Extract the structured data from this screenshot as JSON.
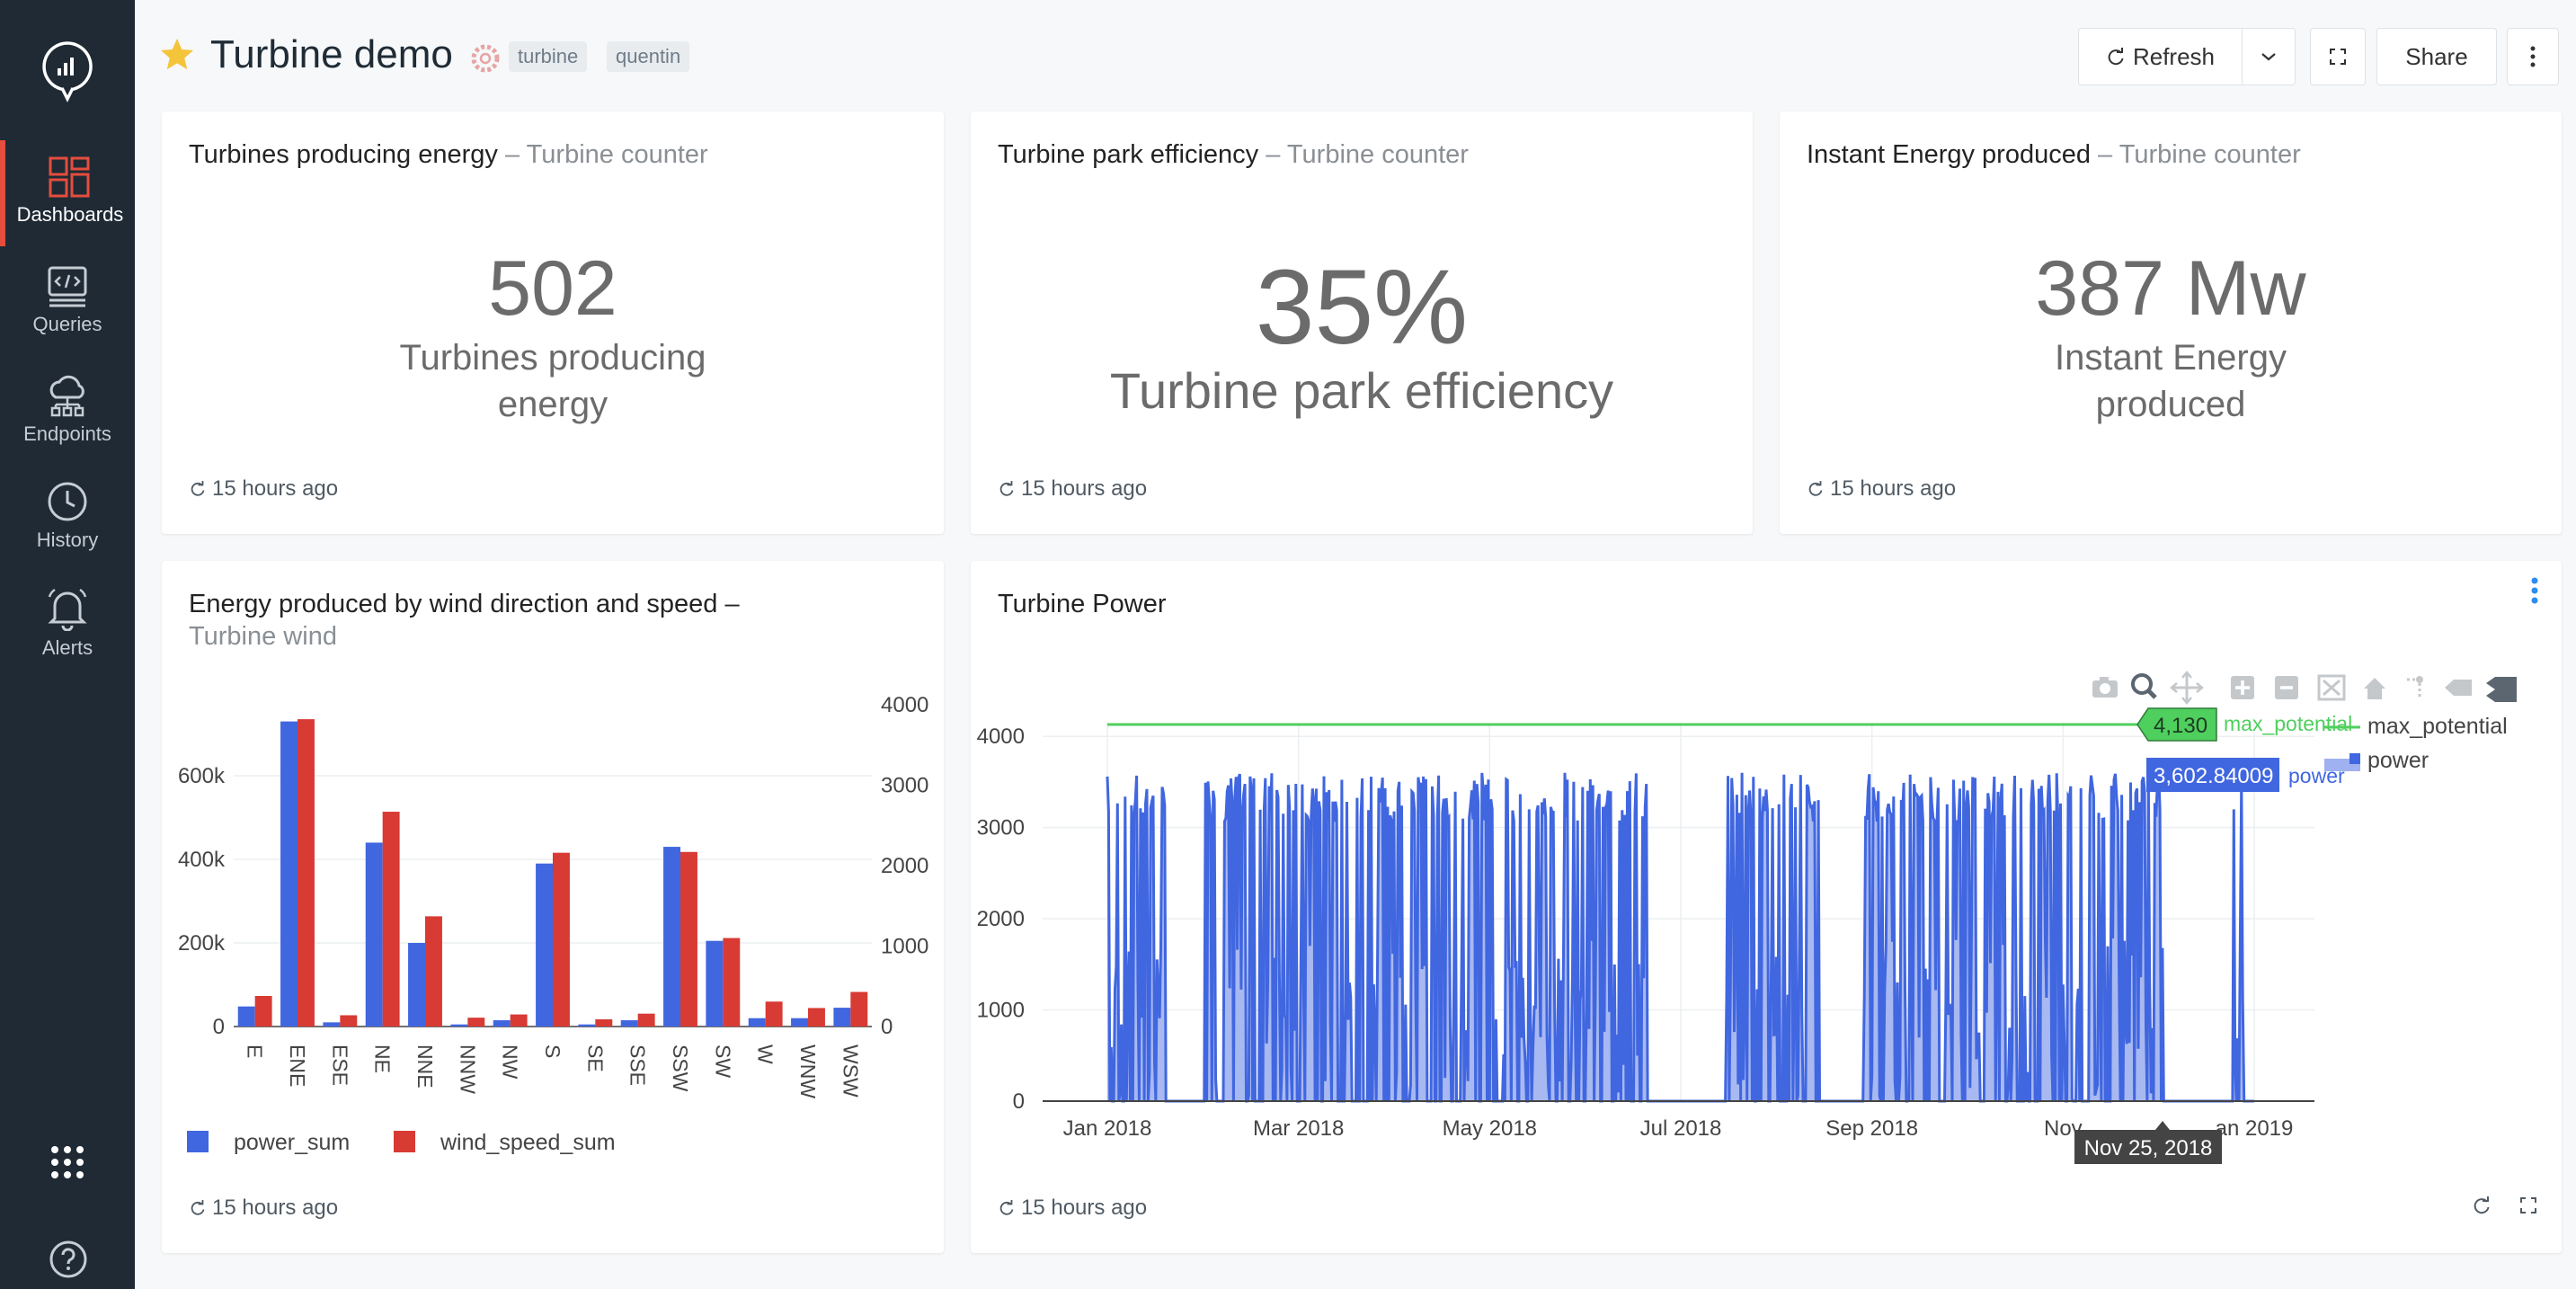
{
  "sidebar": {
    "items": [
      {
        "label": "Dashboards"
      },
      {
        "label": "Queries"
      },
      {
        "label": "Endpoints"
      },
      {
        "label": "History"
      },
      {
        "label": "Alerts"
      }
    ]
  },
  "header": {
    "title": "Turbine demo",
    "tags": [
      "turbine",
      "quentin"
    ],
    "refresh_label": "Refresh",
    "share_label": "Share"
  },
  "widgets": {
    "counter1": {
      "title": "Turbines producing energy",
      "query": "Turbine counter",
      "value": "502",
      "label_line1": "Turbines producing",
      "label_line2": "energy",
      "updated": "15 hours ago"
    },
    "counter2": {
      "title": "Turbine park efficiency",
      "query": "Turbine counter",
      "value": "35%",
      "label": "Turbine park efficiency",
      "updated": "15 hours ago"
    },
    "counter3": {
      "title": "Instant Energy produced",
      "query": "Turbine counter",
      "value": "387 Mw",
      "label_line1": "Instant Energy",
      "label_line2": "produced",
      "updated": "15 hours ago"
    },
    "bar_chart": {
      "title": "Energy produced by wind direction and speed",
      "dash": "–",
      "query": "Turbine wind",
      "updated": "15 hours ago"
    },
    "line_chart": {
      "title": "Turbine Power",
      "updated": "15 hours ago"
    }
  },
  "colors": {
    "accent": "#e54d3d",
    "sidebar": "#1f2a35",
    "blue": "#4066e0",
    "red": "#d83a34",
    "green": "#4fcf5d"
  },
  "chart_data": [
    {
      "type": "bar",
      "categories": [
        "E",
        "ENE",
        "ESE",
        "NE",
        "NNE",
        "NNW",
        "NW",
        "S",
        "SE",
        "SSE",
        "SSW",
        "SW",
        "W",
        "WNW",
        "WSW"
      ],
      "y_ticks_left": [
        "0",
        "200k",
        "400k",
        "600k"
      ],
      "y_ticks_right": [
        "0",
        "1000",
        "2000",
        "3000",
        "4000"
      ],
      "ylim_left": [
        0,
        770000
      ],
      "ylim_right": [
        0,
        4000
      ],
      "series": [
        {
          "name": "power_sum",
          "axis": "left",
          "color": "#4066e0",
          "values": [
            48000,
            730000,
            10000,
            440000,
            200000,
            5000,
            15000,
            390000,
            5000,
            15000,
            430000,
            205000,
            20000,
            20000,
            45000
          ]
        },
        {
          "name": "wind_speed_sum",
          "axis": "right",
          "color": "#d83a34",
          "values": [
            380,
            3820,
            140,
            2670,
            1370,
            110,
            150,
            2160,
            90,
            160,
            2170,
            1100,
            310,
            230,
            430
          ]
        }
      ],
      "legend": "bottom-left"
    },
    {
      "type": "line",
      "x_ticks": [
        "Jan 2018",
        "Mar 2018",
        "May 2018",
        "Jul 2018",
        "Sep 2018",
        "Nov",
        "an 2019"
      ],
      "y_ticks": [
        "0",
        "1000",
        "2000",
        "3000",
        "4000"
      ],
      "ylim": [
        0,
        4150
      ],
      "series": [
        {
          "name": "max_potential",
          "color": "#4fcf5d",
          "value": 4130
        },
        {
          "name": "power",
          "color": "#4066e0",
          "max": 3602.84009
        }
      ],
      "hover": {
        "max_potential_value": "4,130",
        "power_value": "3,602.84009",
        "x": "Nov 25, 2018"
      },
      "legend": "top-right"
    }
  ]
}
